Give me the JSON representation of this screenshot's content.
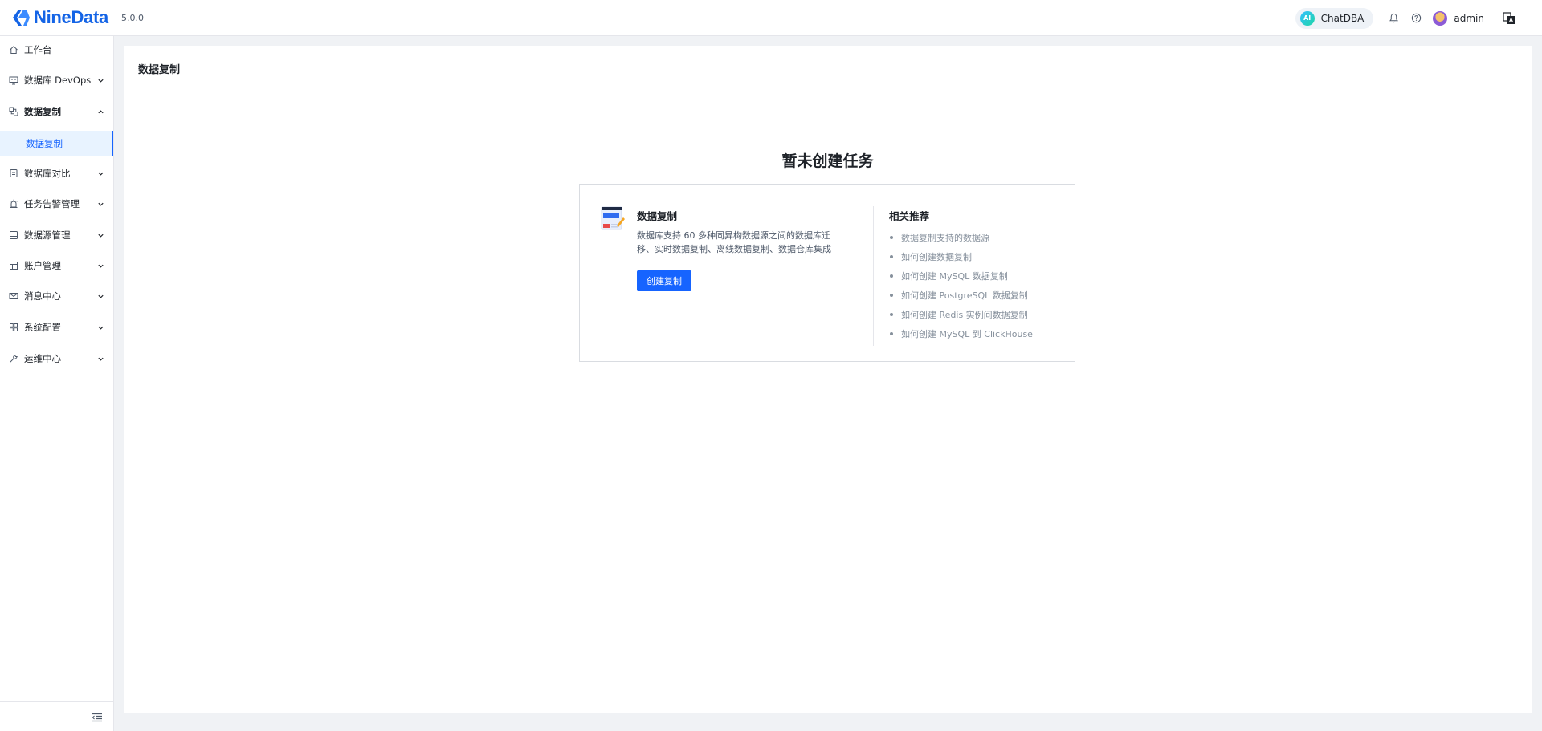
{
  "header": {
    "brand": "NineData",
    "version": "5.0.0",
    "chatdba": {
      "badge": "AI",
      "label": "ChatDBA"
    },
    "user": "admin",
    "brand_color": "#1464e6"
  },
  "sidebar": {
    "items": [
      {
        "label": "工作台",
        "icon": "home-icon"
      },
      {
        "label": "数据库 DevOps",
        "icon": "monitor-icon"
      },
      {
        "label": "数据复制",
        "icon": "replication-icon"
      },
      {
        "label": "数据库对比",
        "icon": "compare-icon"
      },
      {
        "label": "任务告警管理",
        "icon": "alarm-icon"
      },
      {
        "label": "数据源管理",
        "icon": "datasource-icon"
      },
      {
        "label": "账户管理",
        "icon": "account-icon"
      },
      {
        "label": "消息中心",
        "icon": "mail-icon"
      },
      {
        "label": "系统配置",
        "icon": "grid-icon"
      },
      {
        "label": "运维中心",
        "icon": "wrench-icon"
      }
    ],
    "active_sub": "数据复制",
    "accent": "#1664ff"
  },
  "main": {
    "page_title": "数据复制",
    "empty_title": "暂未创建任务",
    "card": {
      "title": "数据复制",
      "description": "数据库支持 60 多种同异构数据源之间的数据库迁移、实时数据复制、离线数据复制、数据仓库集成",
      "button": "创建复制"
    },
    "recommend": {
      "title": "相关推荐",
      "links": [
        "数据复制支持的数据源",
        "如何创建数据复制",
        "如何创建 MySQL 数据复制",
        "如何创建 PostgreSQL 数据复制",
        "如何创建 Redis 实例间数据复制",
        "如何创建 MySQL 到 ClickHouse"
      ]
    }
  }
}
